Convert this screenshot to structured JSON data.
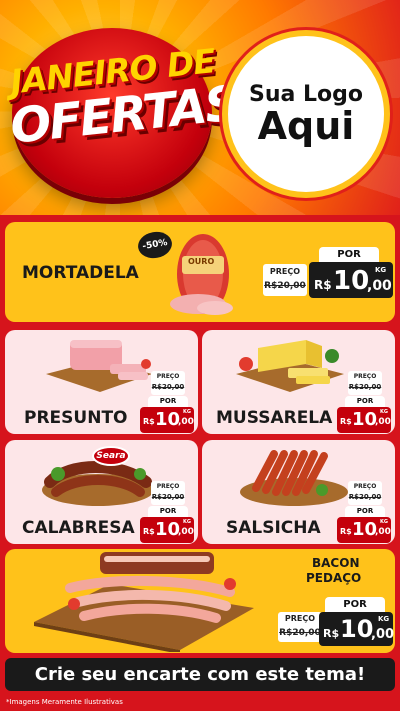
{
  "header": {
    "title_line1": "JANEIRO DE",
    "title_line2": "OFERTAS",
    "logo_line1": "Sua Logo",
    "logo_line2": "Aqui"
  },
  "products": {
    "mortadela": {
      "name": "MORTADELA",
      "badge": "-50%",
      "brand": "OURO",
      "price_label": "PREÇO",
      "old_price": "R$20,00",
      "per_label": "POR",
      "currency": "R$",
      "price_int": "10",
      "price_dec": ",00",
      "unit": "KG"
    },
    "presunto": {
      "name": "PRESUNTO",
      "price_label": "PREÇO",
      "old_price": "R$20,00",
      "per_label": "POR",
      "currency": "R$",
      "price_int": "10",
      "price_dec": ",00",
      "unit": "KG"
    },
    "mussarela": {
      "name": "MUSSARELA",
      "price_label": "PREÇO",
      "old_price": "R$20,00",
      "per_label": "POR",
      "currency": "R$",
      "price_int": "10",
      "price_dec": ",00",
      "unit": "KG"
    },
    "calabresa": {
      "name": "CALABRESA",
      "brand": "Seara",
      "price_label": "PREÇO",
      "old_price": "R$20,00",
      "per_label": "POR",
      "currency": "R$",
      "price_int": "10",
      "price_dec": ",00",
      "unit": "KG"
    },
    "salsicha": {
      "name": "SALSICHA",
      "price_label": "PREÇO",
      "old_price": "R$20,00",
      "per_label": "POR",
      "currency": "R$",
      "price_int": "10",
      "price_dec": ",00",
      "unit": "KG"
    },
    "bacon": {
      "name_line1": "BACON",
      "name_line2": "PEDAÇO",
      "price_label": "PREÇO",
      "old_price": "R$20,00",
      "per_label": "POR",
      "currency": "R$",
      "price_int": "10",
      "price_dec": ",00",
      "unit": "KG"
    }
  },
  "footer": {
    "cta": "Crie seu encarte com este tema!",
    "disclaimer": "*Imagens Meramente Ilustrativas"
  },
  "colors": {
    "red": "#d6141c",
    "dark_red": "#c4000c",
    "yellow": "#ffc21a",
    "pink": "#fde6e8",
    "black": "#1a1a1a"
  }
}
